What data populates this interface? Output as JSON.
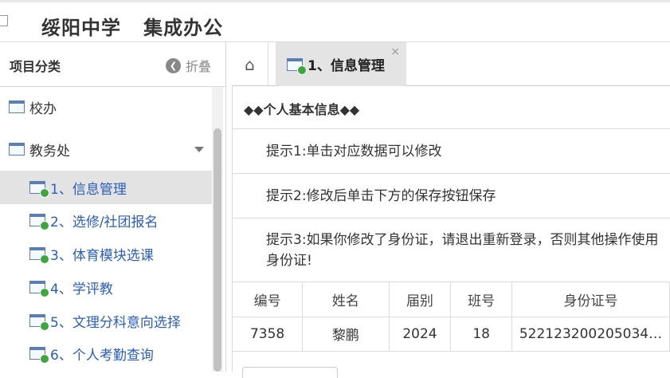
{
  "header": {
    "title": "绥阳中学   集成办公"
  },
  "sidebar": {
    "title": "项目分类",
    "collapse_label": "折叠",
    "items": [
      {
        "label": "校办"
      },
      {
        "label": "教务处"
      },
      {
        "label": "1、信息管理"
      },
      {
        "label": "2、选修/社团报名"
      },
      {
        "label": "3、体育模块选课"
      },
      {
        "label": "4、学评教"
      },
      {
        "label": "5、文理分科意向选择"
      },
      {
        "label": "6、个人考勤查询"
      }
    ]
  },
  "tabs": {
    "active_label": "1、信息管理",
    "close": "×"
  },
  "content": {
    "section_title": "◆◆个人基本信息◆◆",
    "tip1": "提示1:单击对应数据可以修改",
    "tip2": "提示2:修改后单击下方的保存按钮保存",
    "tip3_line1": "提示3:如果你修改了身份证，请退出重新登录，否则其他操作使用",
    "tip3_line2": "身份证!"
  },
  "table": {
    "headers": [
      "编号",
      "姓名",
      "届别",
      "班号",
      "身份证号"
    ],
    "row": [
      "7358",
      "黎鹏",
      "2024",
      "18",
      "52212320020503​4…"
    ]
  }
}
